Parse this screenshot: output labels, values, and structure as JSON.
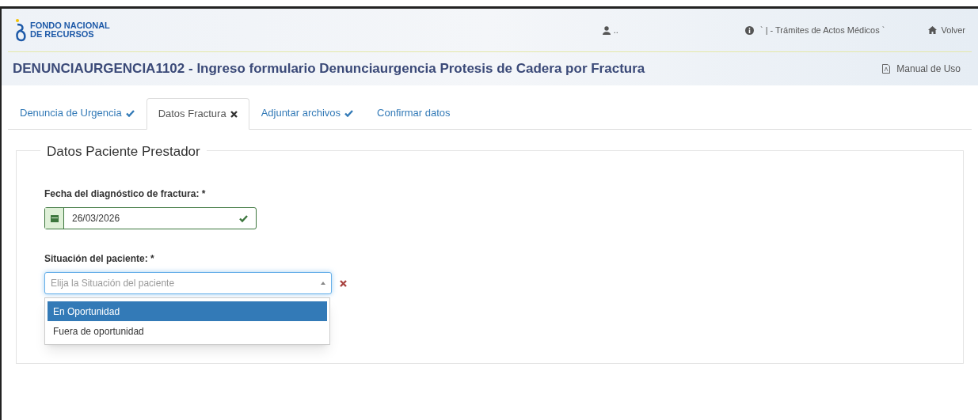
{
  "header": {
    "logo": [
      "FONDO NACIONAL",
      "DE RECURSOS"
    ],
    "user": "..",
    "context": "` | - Trámites de Actos Médicos `",
    "back_link": "Volver"
  },
  "title": "DENUNCIAURGENCIA1102 - Ingreso formulario Denunciaurgencia Protesis de Cadera por Fractura",
  "manual_link": "Manual de Uso",
  "tabs": [
    {
      "label": "Denuncia de Urgencia",
      "kind": "complete",
      "selected": false
    },
    {
      "label": "Datos Fractura",
      "kind": "invalid",
      "selected": true
    },
    {
      "label": "Adjuntar archivos",
      "kind": "complete",
      "selected": false
    },
    {
      "label": "Confirmar datos",
      "kind": "plain",
      "selected": false
    }
  ],
  "section": {
    "legend": "Datos Paciente Prestador",
    "date_field": {
      "label": "Fecha del diagnóstico de fractura: *",
      "value": "26/03/2026",
      "valid": true
    },
    "select_field": {
      "label": "Situación del paciente: *",
      "placeholder": "Elija la Situación del paciente",
      "valid": false,
      "expanded": true,
      "options": [
        {
          "label": "En Oportunidad",
          "selected": true
        },
        {
          "label": "Fuera de oportunidad",
          "selected": false
        }
      ]
    }
  }
}
